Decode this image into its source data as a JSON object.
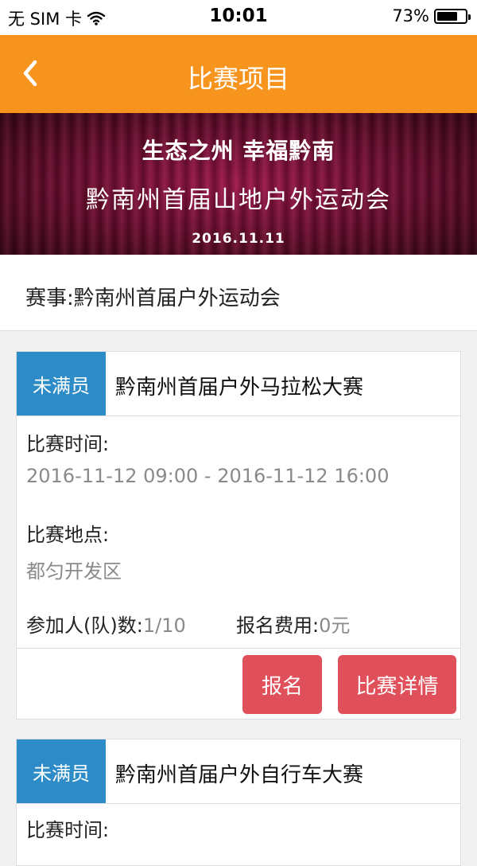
{
  "status_bar": {
    "carrier": "无 SIM 卡",
    "time": "10:01",
    "battery_text": "73%",
    "battery_level": 0.73,
    "icons": [
      "wifi-icon",
      "battery-icon"
    ]
  },
  "nav": {
    "title": "比赛项目",
    "back_icon": "chevron-left-icon",
    "background_color": "#f7941e"
  },
  "banner": {
    "line1": "生态之州  幸福黔南",
    "line2": "黔南州首届山地户外运动会",
    "date": "2016.11.11"
  },
  "event": {
    "text": "赛事:黔南州首届户外运动会"
  },
  "cards": [
    {
      "status": "未满员",
      "title": "黔南州首届户外马拉松大赛",
      "time_label": "比赛时间:",
      "time_value": "2016-11-12 09:00 - 2016-11-12 16:00",
      "location_label": "比赛地点:",
      "location_value": "都匀开发区",
      "participants_label": "参加人(队)数:",
      "participants_value": "1/10",
      "fee_label": "报名费用:",
      "fee_value": "0元",
      "signup_label": "报名",
      "details_label": "比赛详情"
    },
    {
      "status": "未满员",
      "title": "黔南州首届户外自行车大赛",
      "time_label": "比赛时间:"
    }
  ],
  "colors": {
    "status_tag": "#2d8cc7",
    "button": "#e0505a"
  }
}
